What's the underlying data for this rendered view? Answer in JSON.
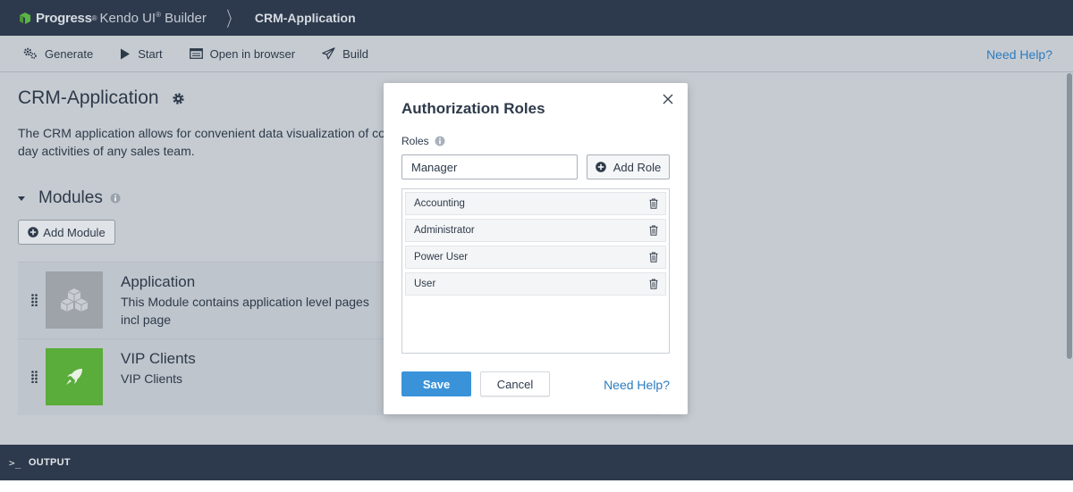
{
  "header": {
    "brand": "Progress",
    "product": "Kendo UI",
    "product_suffix": "Builder",
    "breadcrumb": "CRM-Application"
  },
  "toolbar": {
    "items": [
      {
        "label": "Generate",
        "icon": "gears-icon"
      },
      {
        "label": "Start",
        "icon": "play-icon"
      },
      {
        "label": "Open in browser",
        "icon": "browser-icon"
      },
      {
        "label": "Build",
        "icon": "paper-plane-icon"
      }
    ],
    "help_label": "Need Help?"
  },
  "page": {
    "title": "CRM-Application",
    "description_line1": "The CRM application allows for convenient data visualization of cont",
    "description_line2": "day activities of any sales team."
  },
  "modules": {
    "heading": "Modules",
    "add_label": "Add Module",
    "items": [
      {
        "title": "Application",
        "description": "This Module contains application level pages incl page",
        "thumb_color": "#9ea3a9",
        "icon": "cubes-icon"
      },
      {
        "title": "VIP Clients",
        "description": "VIP Clients",
        "thumb_color": "#5aac3b",
        "icon": "rocket-icon"
      }
    ]
  },
  "modal": {
    "title": "Authorization Roles",
    "roles_label": "Roles",
    "input_value": "Manager",
    "add_role_label": "Add Role",
    "roles": [
      "Accounting",
      "Administrator",
      "Power User",
      "User"
    ],
    "save_label": "Save",
    "cancel_label": "Cancel",
    "help_label": "Need Help?"
  },
  "output": {
    "prompt": ">_",
    "label": "OUTPUT"
  },
  "colors": {
    "topbar": "#2d3a4d",
    "accent": "#3a93d9",
    "link": "#2b7cbf"
  }
}
